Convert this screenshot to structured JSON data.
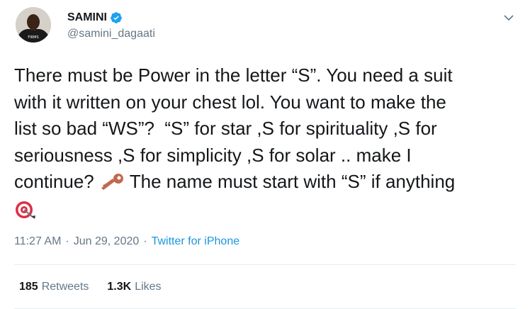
{
  "author": {
    "display_name": "SAMINI",
    "handle": "@samini_dagaati",
    "verified": true,
    "avatar_shirt_text": "FIRMS"
  },
  "tweet": {
    "lines": [
      "There must be Power in the letter “S”. You need a suit",
      "with it written on your chest lol. You want to make the",
      "list so bad “WS”?  “S” for star ,S for spirituality ,S for",
      "seriousness ,S for simplicity ,S for solar .. make I",
      "continue? ",
      " The name must start with “S” if anything"
    ],
    "emojis": [
      "key-emoji",
      "direct-hit-emoji"
    ]
  },
  "meta": {
    "time": "11:27 AM",
    "separator": "·",
    "date": "Jun 29, 2020",
    "source": "Twitter for iPhone"
  },
  "stats": {
    "retweets_count": "185",
    "retweets_label": "Retweets",
    "likes_count": "1.3K",
    "likes_label": "Likes"
  },
  "colors": {
    "text": "#14171a",
    "secondary": "#657786",
    "link": "#1b95e0",
    "verified": "#1da1f2",
    "divider": "#e6ecf0"
  }
}
